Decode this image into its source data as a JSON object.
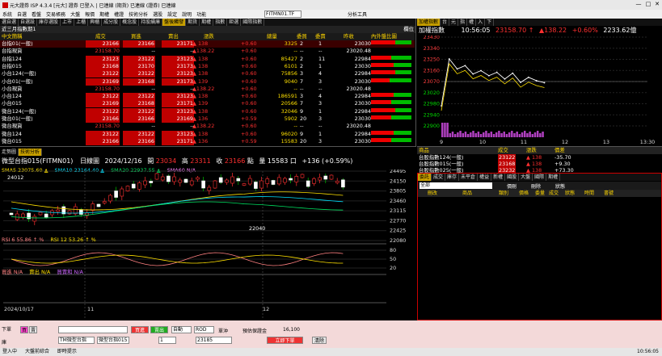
{
  "window": {
    "title": "元大證券 ISP 4.3.4 [元大] 證券 已登入 | 已連線 (期貨) 已連線 (證券) 已連線",
    "minimize": "—",
    "maximize": "□",
    "close": "✕"
  },
  "menu": {
    "items": [
      "系統",
      "自選",
      "看盤",
      "交易帳務",
      "大盤",
      "報價",
      "期權",
      "權證",
      "技術分析",
      "選股",
      "設定",
      "說明",
      "功能"
    ],
    "quote_input": "FITMN01.TF",
    "analysis_tools": "分析工具"
  },
  "left_tabs": [
    "選自選",
    "自選設",
    "庫存選股",
    "上市",
    "上櫃",
    "興櫃",
    "成分股",
    "概念股",
    "持股續庫",
    "盤後觸發",
    "期貨",
    "期權",
    "指數",
    "鉅選",
    "國際指數"
  ],
  "watchlist": {
    "title": "近三月指數期1",
    "corner": "欄位",
    "headers": [
      "中文簡稱",
      "成交",
      "買進",
      "賣出",
      "漲跌",
      "",
      "總量",
      "委買",
      "委賣",
      "昨收",
      "內外盤比圖"
    ],
    "rows": [
      {
        "name": "台指01(一般)",
        "last": "23166",
        "bid": "23166",
        "ask": "23171",
        "chg": "▲ 138",
        "pct": "+0.60",
        "vol": "3325",
        "b": "2",
        "a": "1",
        "prev": "23030",
        "ratio": 0.6,
        "hl": true
      },
      {
        "name": "台指現貨",
        "last": "23158.70",
        "bid": "--",
        "ask": "--",
        "chg": "▲138.22",
        "pct": "+0.60",
        "vol": "--",
        "b": "--",
        "a": "--",
        "prev": "23020.48",
        "ratio": 0,
        "hl": false
      },
      {
        "name": "台指124",
        "last": "23123",
        "bid": "23122",
        "ask": "23123",
        "chg": "▲ 138",
        "pct": "+0.60",
        "vol": "85427",
        "b": "2",
        "a": "11",
        "prev": "22984",
        "ratio": 0.5,
        "hl": false
      },
      {
        "name": "台指015",
        "last": "23168",
        "bid": "23170",
        "ask": "23173",
        "chg": "▲ 138",
        "pct": "+0.60",
        "vol": "6101",
        "b": "2",
        "a": "1",
        "prev": "23030",
        "ratio": 0.55,
        "hl": false
      },
      {
        "name": "小台124(一般)",
        "last": "23122",
        "bid": "23122",
        "ask": "23123",
        "chg": "▲ 138",
        "pct": "+0.60",
        "vol": "75856",
        "b": "3",
        "a": "4",
        "prev": "22984",
        "ratio": 0.6,
        "hl": false
      },
      {
        "name": "小台01(一般)",
        "last": "23169",
        "bid": "23168",
        "ask": "23173",
        "chg": "▲ 139",
        "pct": "+0.60",
        "vol": "9040",
        "b": "7",
        "a": "3",
        "prev": "23030",
        "ratio": 0.45,
        "hl": false
      },
      {
        "name": "小台現貨",
        "last": "23158.70",
        "bid": "--",
        "ask": "--",
        "chg": "▲138.22",
        "pct": "+0.60",
        "vol": "--",
        "b": "--",
        "a": "--",
        "prev": "23020.48",
        "ratio": 0,
        "hl": false
      },
      {
        "name": "小台124",
        "last": "23122",
        "bid": "23122",
        "ask": "23123",
        "chg": "▲ 138",
        "pct": "+0.60",
        "vol": "186591",
        "b": "3",
        "a": "4",
        "prev": "22984",
        "ratio": 0.55,
        "hl": false
      },
      {
        "name": "小台015",
        "last": "23169",
        "bid": "23168",
        "ask": "23171",
        "chg": "▲ 139",
        "pct": "+0.60",
        "vol": "20566",
        "b": "7",
        "a": "3",
        "prev": "23030",
        "ratio": 0.5,
        "hl": false
      },
      {
        "name": "微台124(一般)",
        "last": "23122",
        "bid": "23122",
        "ask": "23123",
        "chg": "▲ 138",
        "pct": "+0.60",
        "vol": "32046",
        "b": "9",
        "a": "1",
        "prev": "22984",
        "ratio": 0.6,
        "hl": false
      },
      {
        "name": "微台01(一般)",
        "last": "23166",
        "bid": "23166",
        "ask": "23169",
        "chg": "▲ 136",
        "pct": "+0.59",
        "vol": "5902",
        "b": "20",
        "a": "3",
        "prev": "23030",
        "ratio": 0.5,
        "hl": false
      },
      {
        "name": "微台現貨",
        "last": "23158.70",
        "bid": "--",
        "ask": "--",
        "chg": "▲138.22",
        "pct": "+0.60",
        "vol": "--",
        "b": "--",
        "a": "--",
        "prev": "23020.48",
        "ratio": 0,
        "hl": false
      },
      {
        "name": "微台124",
        "last": "23122",
        "bid": "23122",
        "ask": "23123",
        "chg": "▲ 138",
        "pct": "+0.60",
        "vol": "96020",
        "b": "9",
        "a": "1",
        "prev": "22984",
        "ratio": 0.55,
        "hl": false
      },
      {
        "name": "微台015",
        "last": "23166",
        "bid": "23166",
        "ask": "23171",
        "chg": "▲ 136",
        "pct": "+0.59",
        "vol": "15583",
        "b": "20",
        "a": "3",
        "prev": "23030",
        "ratio": 0.5,
        "hl": false
      }
    ]
  },
  "chart_tabs": [
    "走勢圖",
    "技術分析"
  ],
  "kchart": {
    "symbol": "微型台指015(FITMN01)",
    "period": "日線圖",
    "date": "2024/12/16",
    "open_label": "開",
    "open": "23034",
    "high_label": "高",
    "high": "23311",
    "close_label": "收",
    "close": "23166",
    "pts_label": "點",
    "vol_label": "量",
    "vol": "15583",
    "lots_label": "口",
    "change": "+136 (+0.59%)",
    "sma5": "SMA5 23075.60 ▲",
    "sma10": "SMA10 23164.40 ▲",
    "sma20": "SMA20 22937.55 ▲",
    "sma60": "SMA60 N/A",
    "yticks": [
      "24495",
      "24150",
      "23805",
      "23460",
      "23115",
      "22770",
      "22425",
      "22080"
    ],
    "hi_mark": "24012",
    "lo_mark": "22040",
    "rsi6": "RSI 6 55.86 ↑ %",
    "rsi12": "RSI 12 53.26 ↑ %",
    "rsi_ticks": [
      "80",
      "50",
      "20"
    ],
    "buy": "買進 N/A",
    "sell": "賣出 N/A",
    "sum": "買賣和 N/A",
    "xlabels": [
      "2024/10/17",
      "11",
      "12"
    ]
  },
  "index_panel": {
    "tabs": [
      "加權指數",
      "台",
      "元",
      "指",
      "權",
      "入",
      "下"
    ],
    "title": "加權指數",
    "time": "10:56:05",
    "price": "23158.70 ↑",
    "change": "▲138.22",
    "pct": "+0.60%",
    "vol": "2233.62億",
    "yticks": [
      "23430",
      "23340",
      "23250",
      "23160",
      "23070",
      "23020",
      "22980",
      "22940",
      "22900"
    ],
    "xticks": [
      "9",
      "10",
      "11",
      "12",
      "13",
      "13:30"
    ]
  },
  "mini": {
    "headers": [
      "商品",
      "成交",
      "漲跌",
      "價差"
    ],
    "rows": [
      {
        "name": "台股指數124(一般)",
        "last": "23122",
        "chg": "▲ 138",
        "diff": "-35.70"
      },
      {
        "name": "台股指數015(一般)",
        "last": "23168",
        "chg": "▲ 138",
        "diff": "+9.30"
      },
      {
        "name": "台股指數025(一般)",
        "last": "23232",
        "chg": "▲ 138",
        "diff": "+73.30"
      }
    ]
  },
  "orders": {
    "tabs": [
      "委託",
      "成交",
      "庫存",
      "未平倉",
      "權益",
      "新權",
      "國股",
      "大盤",
      "國際",
      "期權"
    ],
    "headers": [
      "刪改",
      "商品",
      "類別",
      "價格",
      "委量",
      "成交",
      "狀態",
      "時間",
      "書號"
    ],
    "filter1": "全部",
    "filter2": "價刪",
    "filter3": "刪除",
    "filter4": "狀態"
  },
  "order_entry": {
    "label1": "下單",
    "label2": "庫",
    "buy": "買進",
    "sell": "賣出",
    "account": "",
    "product": "TM微型台指",
    "product2": "微型台指015",
    "qty": "1",
    "price": "23185",
    "type1": "自動",
    "type2": "ROD",
    "chk": "單沖",
    "margin_label": "預估保證金",
    "margin": "16,100",
    "submit": "立即下單",
    "clear": "清除",
    "buy_btn": "買",
    "sell_btn": "賣"
  },
  "status": {
    "left": "登入中",
    "mid1": "大盤前綜合",
    "mid2": "即時提示",
    "right": "10:56:05"
  },
  "colors": {
    "up": "#ff3030",
    "down": "#00d800",
    "accent": "#ffd700"
  },
  "chart_data": {
    "type": "line",
    "title": "加權指數",
    "x_ticks": [
      "9",
      "10",
      "11",
      "12",
      "13",
      "13:30"
    ],
    "ylim": [
      22900,
      23430
    ],
    "series": [
      {
        "name": "",
        "values": [
          23020,
          23300,
          23240,
          23260,
          23210,
          23230,
          23200,
          23220,
          23180,
          23215,
          23160,
          23190,
          23170,
          23158
        ]
      }
    ]
  }
}
